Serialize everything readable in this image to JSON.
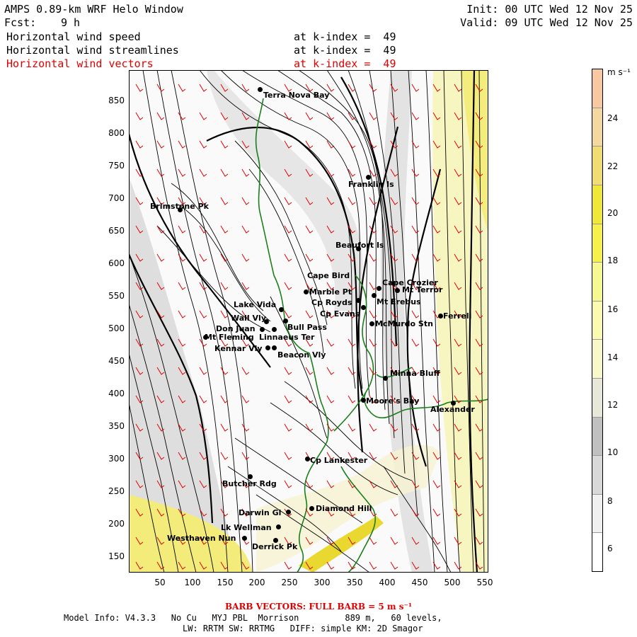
{
  "header": {
    "title": "AMPS 0.89-km WRF Helo Window",
    "fcst_label": "Fcst:",
    "fcst_value": "9 h",
    "init": "Init: 00 UTC Wed 12 Nov 25",
    "valid": "Valid: 09 UTC Wed 12 Nov 25",
    "fields": [
      {
        "name": "Horizontal wind speed",
        "level": "at k-index =  49",
        "color": "#000000"
      },
      {
        "name": "Horizontal wind streamlines",
        "level": "at k-index =  49",
        "color": "#000000"
      },
      {
        "name": "Horizontal wind vectors",
        "level": "at k-index =  49",
        "color": "#e00000"
      }
    ]
  },
  "axes": {
    "x_ticks": [
      "50",
      "100",
      "150",
      "200",
      "250",
      "300",
      "350",
      "400",
      "450",
      "500",
      "550"
    ],
    "y_ticks": [
      "850",
      "800",
      "750",
      "700",
      "650",
      "600",
      "550",
      "500",
      "450",
      "400",
      "350",
      "300",
      "250",
      "200",
      "150"
    ],
    "x_range": [
      0,
      555
    ],
    "y_range": [
      125,
      888
    ]
  },
  "colorbar": {
    "unit": "m s⁻¹",
    "labels": [
      "24",
      "22",
      "20",
      "18",
      "16",
      "14",
      "12",
      "10",
      "8",
      "6"
    ],
    "colors": [
      "#ffffff",
      "#f0f0f0",
      "#d8d8d8",
      "#c0c0c0",
      "#e8e8d8",
      "#f8f8c8",
      "#fafab0",
      "#f8f890",
      "#f5f04a",
      "#f0e838",
      "#f0dc70",
      "#f5d8a0",
      "#f8c8a0"
    ]
  },
  "sites": [
    {
      "name": "Terra Nova Bay"
    },
    {
      "name": "Franklin Is"
    },
    {
      "name": "Brimstone Pk"
    },
    {
      "name": "Beaufort Is"
    },
    {
      "name": "Cape Bird"
    },
    {
      "name": "Cape Crozier"
    },
    {
      "name": "Mt Terror"
    },
    {
      "name": "Marble Pt"
    },
    {
      "name": "Lake Vida"
    },
    {
      "name": "Cp Royds"
    },
    {
      "name": "Mt Erebus"
    },
    {
      "name": "Cp Evans"
    },
    {
      "name": "Wall Vly"
    },
    {
      "name": "Bull Pass"
    },
    {
      "name": "Don Juan"
    },
    {
      "name": "McMurdo Stn"
    },
    {
      "name": "Mt Fleming"
    },
    {
      "name": "Linnaeus Ter"
    },
    {
      "name": "Kennar Vly"
    },
    {
      "name": "Beacon Vly"
    },
    {
      "name": "Minna Bluff"
    },
    {
      "name": "Moore's Bay"
    },
    {
      "name": "Alexander"
    },
    {
      "name": "Cp Lankester"
    },
    {
      "name": "Butcher Rdg"
    },
    {
      "name": "Darwin Gl"
    },
    {
      "name": "Diamond Hill"
    },
    {
      "name": "Lk Wellman"
    },
    {
      "name": "Westhaven Nun"
    },
    {
      "name": "Derrick Pk"
    },
    {
      "name": "Ferrell"
    }
  ],
  "footer": {
    "barb": "BARB VECTORS:  FULL BARB = 5 m s⁻¹",
    "line1": "Model Info: V4.3.3   No Cu   MYJ PBL  Morrison         889 m,   60 levels,",
    "line2": "LW: RRTM SW: RRTMG   DIFF: simple KM: 2D Smagor"
  }
}
